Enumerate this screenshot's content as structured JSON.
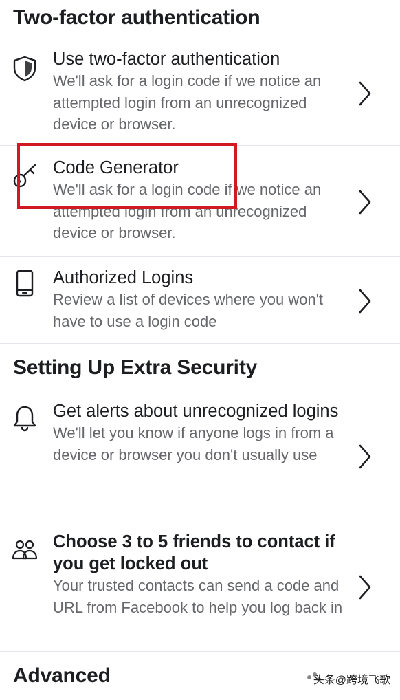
{
  "sections": {
    "two_factor": "Two-factor authentication",
    "extra_security": "Setting Up Extra Security",
    "advanced": "Advanced"
  },
  "rows": [
    {
      "title": "Use two-factor authentication",
      "description": "We'll ask for a login code if we notice an attempted login from an unrecognized device or browser.",
      "icon": "shield-icon"
    },
    {
      "title": "Code Generator",
      "description": "We'll ask for a login code if we notice an attempted login from an unrecognized device or browser.",
      "icon": "key-icon"
    },
    {
      "title": "Authorized Logins",
      "description": "Review a list of devices where you won't have to use a login code",
      "icon": "phone-icon"
    },
    {
      "title": "Get alerts about unrecognized logins",
      "description": "We'll let you know if anyone logs in from a device or browser you don't usually use",
      "icon": "bell-icon"
    },
    {
      "title": "Choose 3 to 5 friends to contact if you get locked out",
      "description": "Your trusted contacts can send a code and URL from Facebook to help you log back in",
      "icon": "friends-icon"
    }
  ],
  "watermark": "头条@跨境飞歌",
  "colors": {
    "highlight": "#d01920",
    "title": "#1c1e21",
    "description": "#65676b",
    "divider": "#e4e6eb"
  }
}
